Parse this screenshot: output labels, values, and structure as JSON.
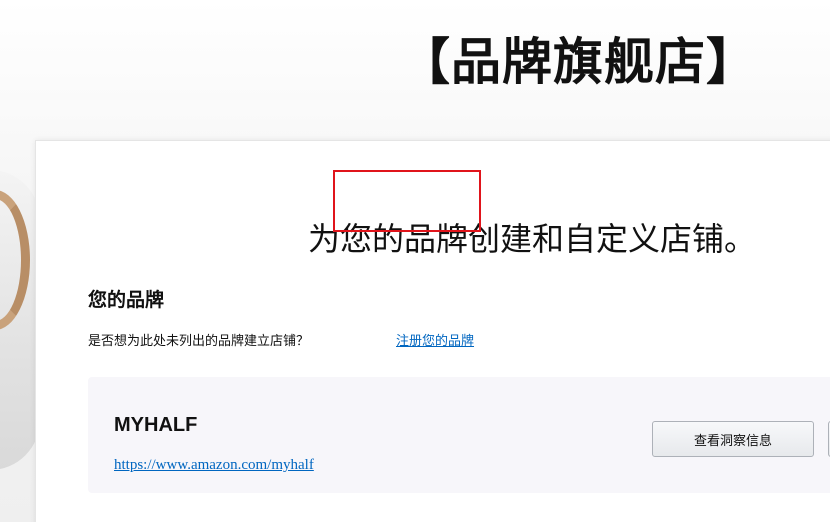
{
  "banner": {
    "title": "【品牌旗舰店】"
  },
  "main": {
    "headline": "为您的品牌创建和自定义店铺。",
    "your_brands": {
      "title": "您的品牌",
      "question": "是否想为此处未列出的品牌建立店铺？",
      "register_link": "注册您的品牌"
    },
    "brands": [
      {
        "name": "MYHALF",
        "url": "https://www.amazon.com/myhalf",
        "insights_button": "查看洞察信息"
      }
    ]
  },
  "colors": {
    "link": "#0066c0",
    "highlight_box": "#e0141b",
    "brand_row_bg": "#f7f6fa"
  }
}
